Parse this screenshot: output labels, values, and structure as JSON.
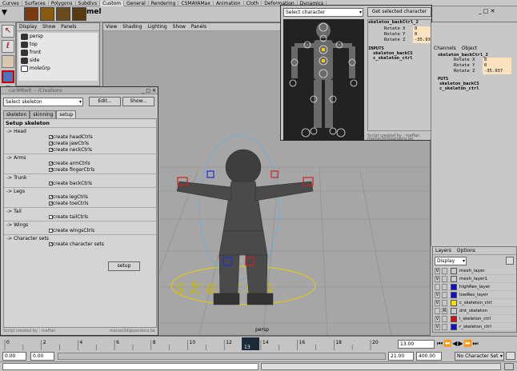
{
  "shelf_tabs": [
    "Curves",
    "Surfaces",
    "Polygons",
    "Subdivs",
    "Custom",
    "General",
    "Rendering",
    "CSMAYAMax",
    "Animation",
    "Cloth",
    "Deformation",
    "Dynamics"
  ],
  "shelf": {
    "mel_label": "mel"
  },
  "outliner": {
    "menu": [
      "Display",
      "Show",
      "Panels"
    ],
    "items": [
      "persp",
      "top",
      "front",
      "side",
      "moleGrp"
    ]
  },
  "viewport": {
    "menu": [
      "View",
      "Shading",
      "Lighting",
      "Show",
      "Panels"
    ],
    "camera_label": "persp"
  },
  "setup_window": {
    "title": "cartMbelt -- iCreations",
    "select_value": "Select skeleton",
    "edit_button": "Edit...",
    "show_button": "Show...",
    "tabs": [
      "skeleton",
      "skinning",
      "setup"
    ],
    "active_tab": "setup",
    "heading": "Setup skeleton",
    "sections": [
      {
        "name": "-> Head",
        "options": [
          {
            "label": "create headCtrls",
            "checked": true
          },
          {
            "label": "create jawCtrls",
            "checked": true
          },
          {
            "label": "create neckCtrls",
            "checked": true
          }
        ]
      },
      {
        "name": "-> Arms",
        "options": [
          {
            "label": "create armCtrls",
            "checked": true
          },
          {
            "label": "create fingerCtrls",
            "checked": true
          }
        ]
      },
      {
        "name": "-> Trunk",
        "options": [
          {
            "label": "create backCtrls",
            "checked": true
          }
        ]
      },
      {
        "name": "-> Legs",
        "options": [
          {
            "label": "create legCtrls",
            "checked": true
          },
          {
            "label": "create toeCtrls",
            "checked": true
          }
        ]
      },
      {
        "name": "-> Tail",
        "options": [
          {
            "label": "create tailCtrls",
            "checked": false
          }
        ]
      },
      {
        "name": "-> Wings",
        "options": [
          {
            "label": "create wingsCtrls",
            "checked": false
          }
        ]
      },
      {
        "name": "-> Character sets",
        "options": [
          {
            "label": "create character sets",
            "checked": true
          }
        ]
      }
    ],
    "setup_button": "setup",
    "footer_left": "Script created by : maffan",
    "footer_right": "manoo3d@pandora.be"
  },
  "picker_window": {
    "select_value": "Select character",
    "get_button": "Get selected character",
    "node": "skeleton_backCtrl_2",
    "attrs": [
      {
        "label": "Rotate X",
        "value": "0"
      },
      {
        "label": "Rotate Y",
        "value": "0"
      },
      {
        "label": "Rotate Z",
        "value": "-35.937"
      }
    ],
    "inputs_label": "INPUTS",
    "inputs": [
      "skeleton_backCS",
      "c_skeleton_ctrl"
    ],
    "footer_left": "Script created by : maffan",
    "footer_right": "manoo3d@pandora.be"
  },
  "channel_box": {
    "menu": [
      "Channels",
      "Object"
    ],
    "node": "skeleton_backCtrl_2",
    "attrs": [
      {
        "label": "Rotate X",
        "value": "0"
      },
      {
        "label": "Rotate Y",
        "value": "0"
      },
      {
        "label": "Rotate Z",
        "value": "-35.937"
      }
    ],
    "inputs_label": "PUTS",
    "inputs": [
      "skeleton_backCS",
      "c_skeleton_ctrl"
    ]
  },
  "layers": {
    "menu": [
      "Layers",
      "Options"
    ],
    "display_value": "Display",
    "rows": [
      {
        "v": "V",
        "r": "",
        "color": "#c8c8c8",
        "name": "mesh_layer"
      },
      {
        "v": "V",
        "r": "",
        "color": "#c8c8c8",
        "name": "mesh_layer1"
      },
      {
        "v": "",
        "r": "",
        "color": "#1010c8",
        "name": "highRes_layer"
      },
      {
        "v": "V",
        "r": "",
        "color": "#1010c8",
        "name": "lowRes_layer"
      },
      {
        "v": "V",
        "r": "",
        "color": "#f0e000",
        "name": "c_skeleton_ctrl"
      },
      {
        "v": "",
        "r": "R",
        "color": "#c8c8c8",
        "name": "dnt_skeleton"
      },
      {
        "v": "V",
        "r": "",
        "color": "#d01010",
        "name": "l_skeleton_ctrl"
      },
      {
        "v": "V",
        "r": "",
        "color": "#1010d0",
        "name": "r_skeleton_ctrl"
      }
    ]
  },
  "timeline": {
    "ticks": [
      "0",
      "2",
      "4",
      "6",
      "8",
      "10",
      "12",
      "14",
      "16",
      "18",
      "20"
    ],
    "current_frame": "13",
    "current_field": "13.00"
  },
  "range": {
    "start": "0.00",
    "anim_start": "0.00",
    "end": "21.00",
    "anim_end": "400.00",
    "character_set": "No Character Set"
  }
}
